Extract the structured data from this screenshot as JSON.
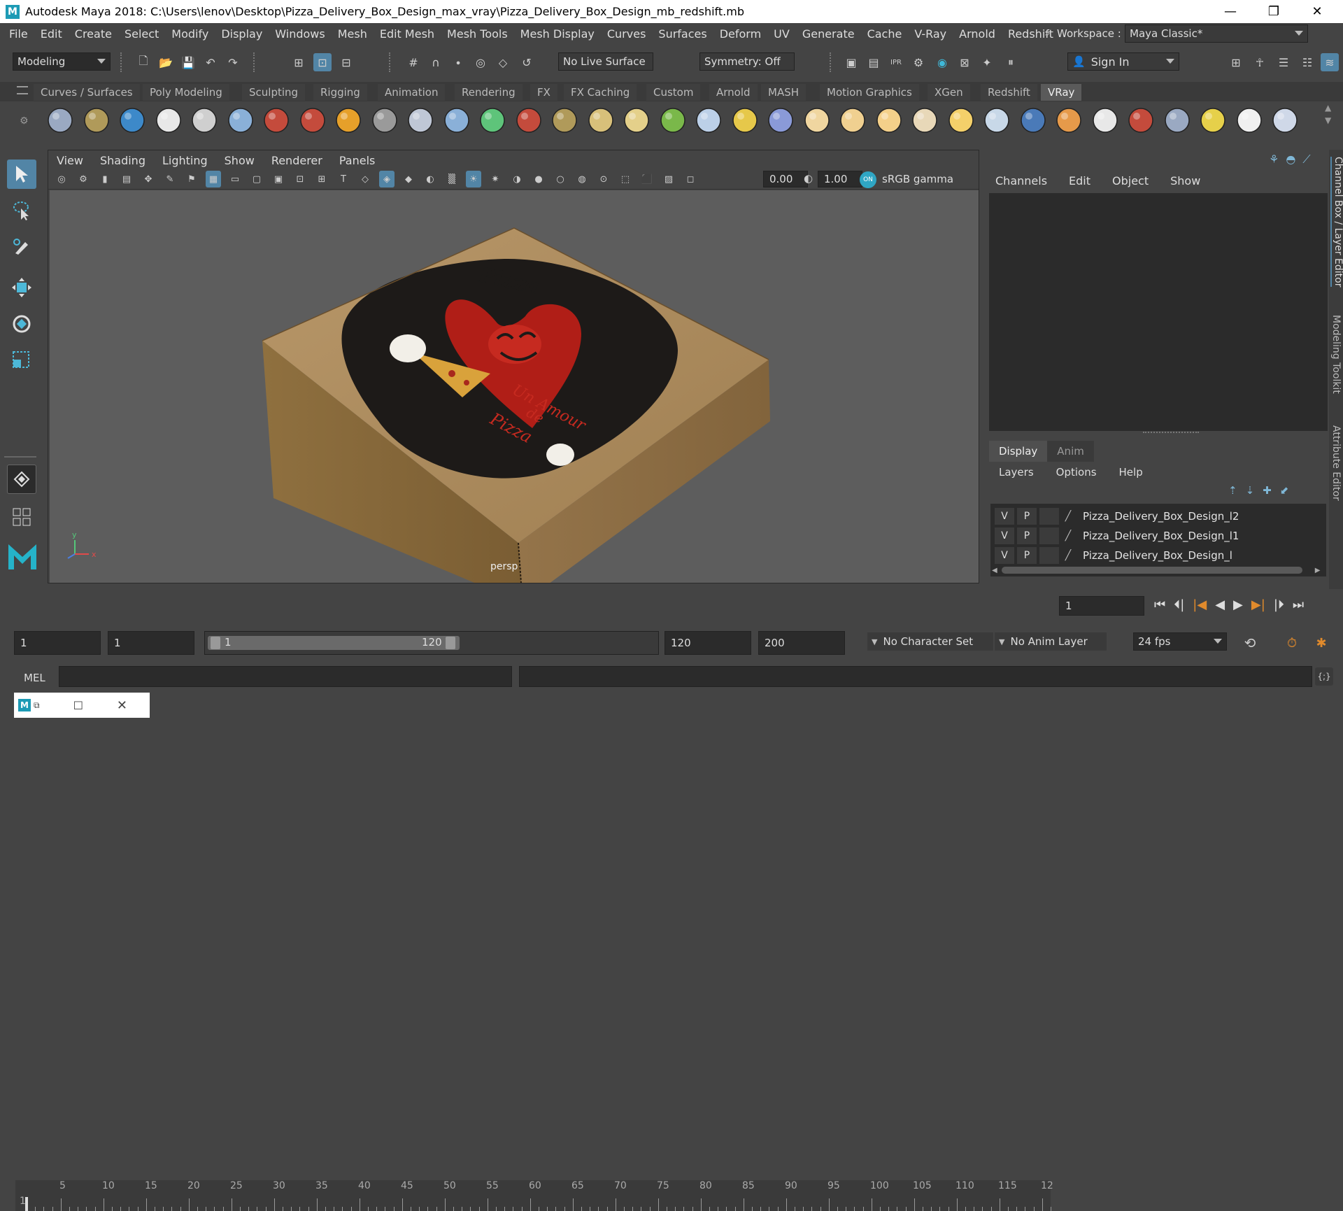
{
  "titlebar": {
    "logo": "M",
    "title": "Autodesk Maya 2018: C:\\Users\\lenov\\Desktop\\Pizza_Delivery_Box_Design_max_vray\\Pizza_Delivery_Box_Design_mb_redshift.mb",
    "minimize": "—",
    "restore": "❐",
    "close": "✕"
  },
  "menubar": {
    "items": [
      "File",
      "Edit",
      "Create",
      "Select",
      "Modify",
      "Display",
      "Windows",
      "Mesh",
      "Edit Mesh",
      "Mesh Tools",
      "Mesh Display",
      "Curves",
      "Surfaces",
      "Deform",
      "UV",
      "Generate",
      "Cache",
      "V-Ray",
      "Arnold",
      "Redshift"
    ],
    "workspace_label": "Workspace :",
    "workspace_value": "Maya Classic*"
  },
  "statusline": {
    "mode": "Modeling",
    "live_surface": "No Live Surface",
    "symmetry": "Symmetry: Off",
    "sign_in": "Sign In"
  },
  "shelf": {
    "tabs": [
      "Curves / Surfaces",
      "Poly Modeling",
      "Sculpting",
      "Rigging",
      "Animation",
      "Rendering",
      "FX",
      "FX Caching",
      "Custom",
      "Arnold",
      "MASH",
      "Motion Graphics",
      "XGen",
      "Redshift",
      "VRay"
    ],
    "active_tab": "VRay"
  },
  "viewport": {
    "menus": [
      "View",
      "Shading",
      "Lighting",
      "Show",
      "Renderer",
      "Panels"
    ],
    "exposure": "0.00",
    "gamma": "1.00",
    "color_space": "sRGB gamma",
    "camera": "persp",
    "box_text": [
      "Pizza",
      "Un Amour",
      "de",
      "Pizza"
    ],
    "axis_y": "y",
    "axis_x": "x"
  },
  "channelbox": {
    "menus": [
      "Channels",
      "Edit",
      "Object",
      "Show"
    ]
  },
  "layereditor": {
    "tabs": [
      "Display",
      "Anim"
    ],
    "active_tab": "Display",
    "menus": [
      "Layers",
      "Options",
      "Help"
    ],
    "layers": [
      {
        "v": "V",
        "p": "P",
        "name": "Pizza_Delivery_Box_Design_l2"
      },
      {
        "v": "V",
        "p": "P",
        "name": "Pizza_Delivery_Box_Design_l1"
      },
      {
        "v": "V",
        "p": "P",
        "name": "Pizza_Delivery_Box_Design_l"
      }
    ]
  },
  "sidebar": {
    "labels": [
      "Channel Box / Layer Editor",
      "Modeling Toolkit",
      "Attribute Editor"
    ]
  },
  "timeline": {
    "ticks": [
      "5",
      "10",
      "15",
      "20",
      "25",
      "30",
      "35",
      "40",
      "45",
      "50",
      "55",
      "60",
      "65",
      "70",
      "75",
      "80",
      "85",
      "90",
      "95",
      "100",
      "105",
      "110",
      "115",
      "12"
    ],
    "start_marker": "1",
    "current_frame": "1"
  },
  "range": {
    "start": "1",
    "playback_start": "1",
    "slider_start": "1",
    "slider_end": "120",
    "playback_end": "120",
    "end": "200",
    "character_set": "No Character Set",
    "anim_layer": "No Anim Layer",
    "fps": "24 fps"
  },
  "mel": {
    "label": "MEL"
  },
  "colors": {
    "accent": "#5285a6",
    "cardboard": "#a8875a",
    "heart": "#b01e17"
  }
}
